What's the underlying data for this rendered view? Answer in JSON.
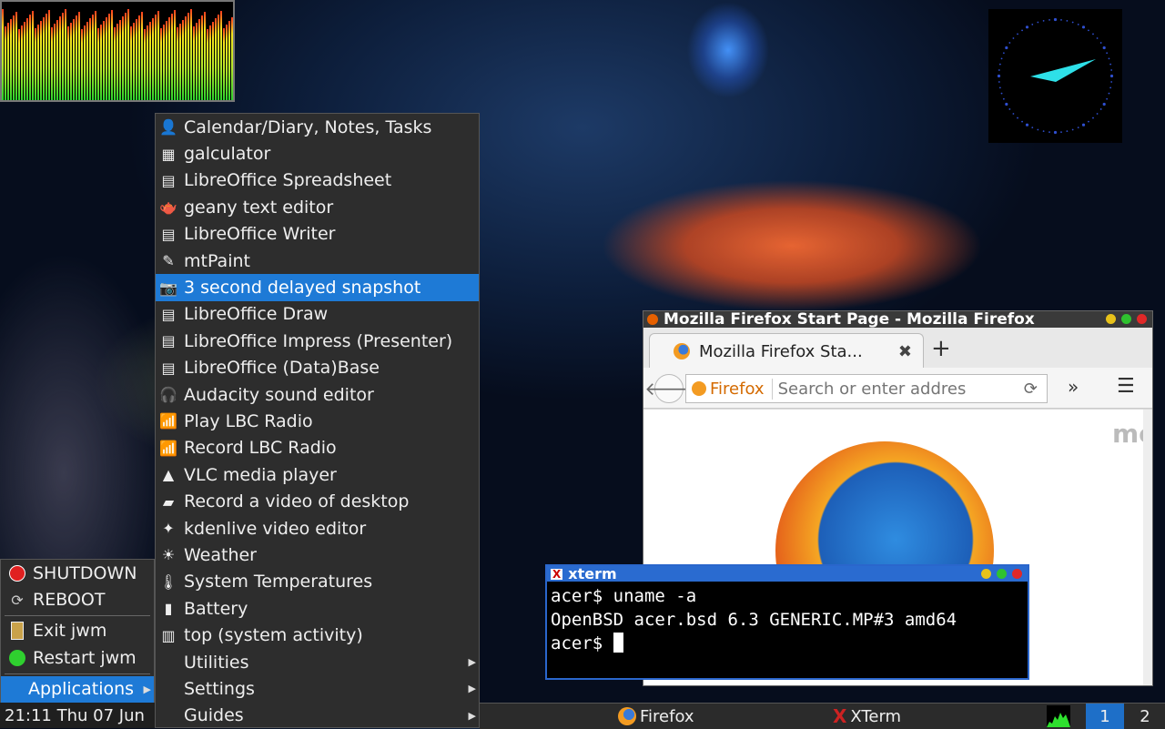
{
  "apps_menu": {
    "items": [
      {
        "label": "Calendar/Diary, Notes, Tasks",
        "icon": "calendar-person-icon",
        "glyph": "👤"
      },
      {
        "label": "galculator",
        "icon": "calculator-icon",
        "glyph": "▦"
      },
      {
        "label": "LibreOffice Spreadsheet",
        "icon": "spreadsheet-icon",
        "glyph": "▤"
      },
      {
        "label": "geany text editor",
        "icon": "geany-icon",
        "glyph": "🫖"
      },
      {
        "label": "LibreOffice Writer",
        "icon": "writer-icon",
        "glyph": "▤"
      },
      {
        "label": "mtPaint",
        "icon": "paint-icon",
        "glyph": "✎"
      },
      {
        "label": "3 second delayed snapshot",
        "icon": "camera-icon",
        "glyph": "📷",
        "active": true
      },
      {
        "label": "LibreOffice Draw",
        "icon": "draw-icon",
        "glyph": "▤"
      },
      {
        "label": "LibreOffice Impress (Presenter)",
        "icon": "impress-icon",
        "glyph": "▤"
      },
      {
        "label": "LibreOffice (Data)Base",
        "icon": "base-icon",
        "glyph": "▤"
      },
      {
        "label": "Audacity sound editor",
        "icon": "headphones-icon",
        "glyph": "🎧"
      },
      {
        "label": "Play LBC Radio",
        "icon": "wifi-icon",
        "glyph": "📶"
      },
      {
        "label": "Record LBC Radio",
        "icon": "wifi-icon",
        "glyph": "📶"
      },
      {
        "label": "VLC media player",
        "icon": "vlc-cone-icon",
        "glyph": "▲"
      },
      {
        "label": "Record a video of desktop",
        "icon": "video-record-icon",
        "glyph": "▰"
      },
      {
        "label": "kdenlive video editor",
        "icon": "kdenlive-icon",
        "glyph": "✦"
      },
      {
        "label": "Weather",
        "icon": "weather-icon",
        "glyph": "☀"
      },
      {
        "label": "System Temperatures",
        "icon": "thermometer-icon",
        "glyph": "🌡"
      },
      {
        "label": "Battery",
        "icon": "battery-icon",
        "glyph": "▮"
      },
      {
        "label": "top (system activity)",
        "icon": "activity-icon",
        "glyph": "▥"
      },
      {
        "label": "Utilities",
        "submenu": true
      },
      {
        "label": "Settings",
        "submenu": true
      },
      {
        "label": "Guides",
        "submenu": true
      }
    ]
  },
  "root_menu": {
    "shutdown": "SHUTDOWN",
    "reboot": "REBOOT",
    "exit": "Exit jwm",
    "restart": "Restart jwm",
    "applications": "Applications"
  },
  "clock_text": "21:11 Thu 07 Jun",
  "taskbar": {
    "firefox": "Firefox",
    "xterm": "XTerm",
    "pager": [
      "1",
      "2"
    ]
  },
  "firefox": {
    "window_title": "Mozilla Firefox Start Page - Mozilla Firefox",
    "tab_title": "Mozilla Firefox Sta...",
    "identity_label": "Firefox",
    "search_placeholder": "Search or enter addres",
    "page_text_partial": "mo"
  },
  "xterm": {
    "title": "xterm",
    "lines": [
      "acer$ uname -a",
      "OpenBSD acer.bsd 6.3 GENERIC.MP#3 amd64"
    ],
    "prompt": "acer$ "
  },
  "colors": {
    "menu_highlight": "#1e7ad6",
    "xterm_title": "#2a6bd0",
    "clock_hand": "#2ee0e8"
  }
}
